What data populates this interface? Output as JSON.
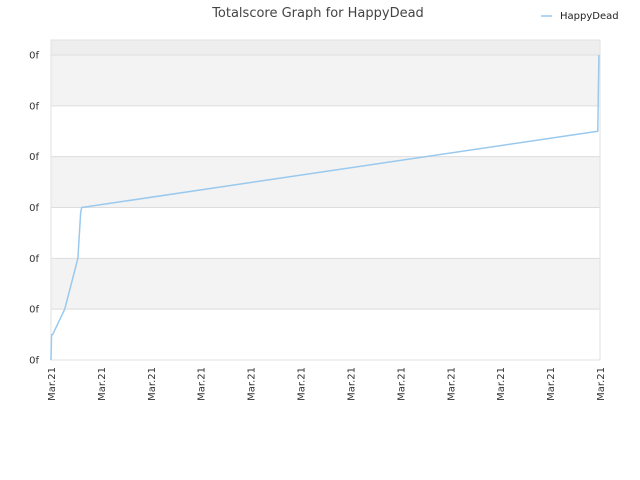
{
  "chart_data": {
    "type": "line",
    "title": "Totalscore Graph for HappyDead",
    "xlabel": "",
    "ylabel": "",
    "x_tick_labels": [
      "Mar.21",
      "Mar.21",
      "Mar.21",
      "Mar.21",
      "Mar.21",
      "Mar.21",
      "Mar.21",
      "Mar.21",
      "Mar.21",
      "Mar.21",
      "Mar.21",
      "Mar.21"
    ],
    "y_tick_labels": [
      "0f",
      "0f",
      "0f",
      "0f",
      "0f",
      "0f",
      "0f"
    ],
    "ylim": [
      0,
      6
    ],
    "xlim": [
      0,
      100
    ],
    "grid": true,
    "legend_position": "top-right",
    "colors": {
      "series": "#99c9ee",
      "band": "#f3f3f3",
      "plot_top_band": "#eeeeee",
      "grid": "#dddddd"
    },
    "series": [
      {
        "name": "HappyDead",
        "x": [
          0.0,
          0.1,
          0.3,
          2.5,
          4.9,
          5.4,
          5.6,
          99.6,
          99.7,
          99.8
        ],
        "y": [
          0.0,
          0.5,
          0.5,
          1.0,
          2.0,
          2.9,
          3.0,
          4.5,
          5.3,
          6.0
        ]
      }
    ]
  }
}
